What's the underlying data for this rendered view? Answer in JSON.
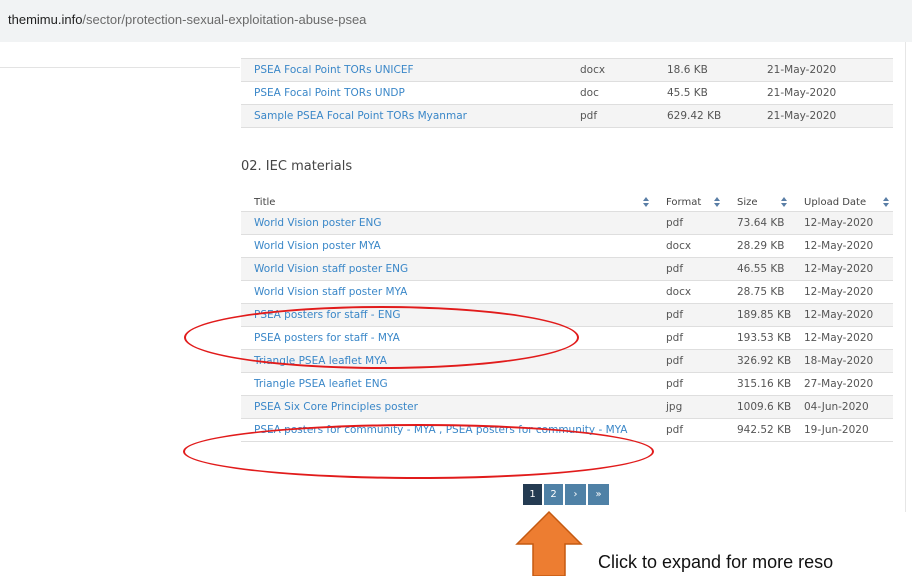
{
  "browser": {
    "url_host": "themimu.info",
    "url_path": "/sector/protection-sexual-exploitation-abuse-psea"
  },
  "top_table": {
    "rows": [
      {
        "title": "PSEA Focal Point TORs UNICEF",
        "format": "docx",
        "size": "18.6 KB",
        "date": "21-May-2020"
      },
      {
        "title": "PSEA Focal Point TORs UNDP",
        "format": "doc",
        "size": "45.5 KB",
        "date": "21-May-2020"
      },
      {
        "title": "Sample PSEA Focal Point TORs Myanmar",
        "format": "pdf",
        "size": "629.42 KB",
        "date": "21-May-2020"
      }
    ]
  },
  "iec": {
    "heading": "02. IEC materials",
    "headers": {
      "title": "Title",
      "format": "Format",
      "size": "Size",
      "date": "Upload Date"
    },
    "rows": [
      {
        "title": "World Vision poster ENG",
        "format": "pdf",
        "size": "73.64 KB",
        "date": "12-May-2020"
      },
      {
        "title": "World Vision poster MYA",
        "format": "docx",
        "size": "28.29 KB",
        "date": "12-May-2020"
      },
      {
        "title": "World Vision staff poster ENG",
        "format": "pdf",
        "size": "46.55 KB",
        "date": "12-May-2020"
      },
      {
        "title": "World Vision staff poster MYA",
        "format": "docx",
        "size": "28.75 KB",
        "date": "12-May-2020"
      },
      {
        "title": "PSEA posters for staff - ENG",
        "format": "pdf",
        "size": "189.85 KB",
        "date": "12-May-2020"
      },
      {
        "title": "PSEA posters for staff - MYA",
        "format": "pdf",
        "size": "193.53 KB",
        "date": "12-May-2020"
      },
      {
        "title": "Triangle PSEA leaflet MYA",
        "format": "pdf",
        "size": "326.92 KB",
        "date": "18-May-2020"
      },
      {
        "title": "Triangle PSEA leaflet ENG",
        "format": "pdf",
        "size": "315.16 KB",
        "date": "27-May-2020"
      },
      {
        "title": "PSEA Six Core Principles poster",
        "format": "jpg",
        "size": "1009.6 KB",
        "date": "04-Jun-2020"
      },
      {
        "title": "PSEA posters for community - MYA , PSEA posters for community - MYA",
        "format": "pdf",
        "size": "942.52 KB",
        "date": "19-Jun-2020"
      }
    ]
  },
  "pagination": {
    "page1": "1",
    "page2": "2",
    "next": "›",
    "last": "»"
  },
  "annotation": {
    "text": "Click to expand for more reso"
  },
  "colors": {
    "link": "#3a87c8",
    "highlight": "#e11b1b",
    "arrow": "#ed7d31",
    "pager": "#4f81a6",
    "pager_active": "#243b52"
  }
}
